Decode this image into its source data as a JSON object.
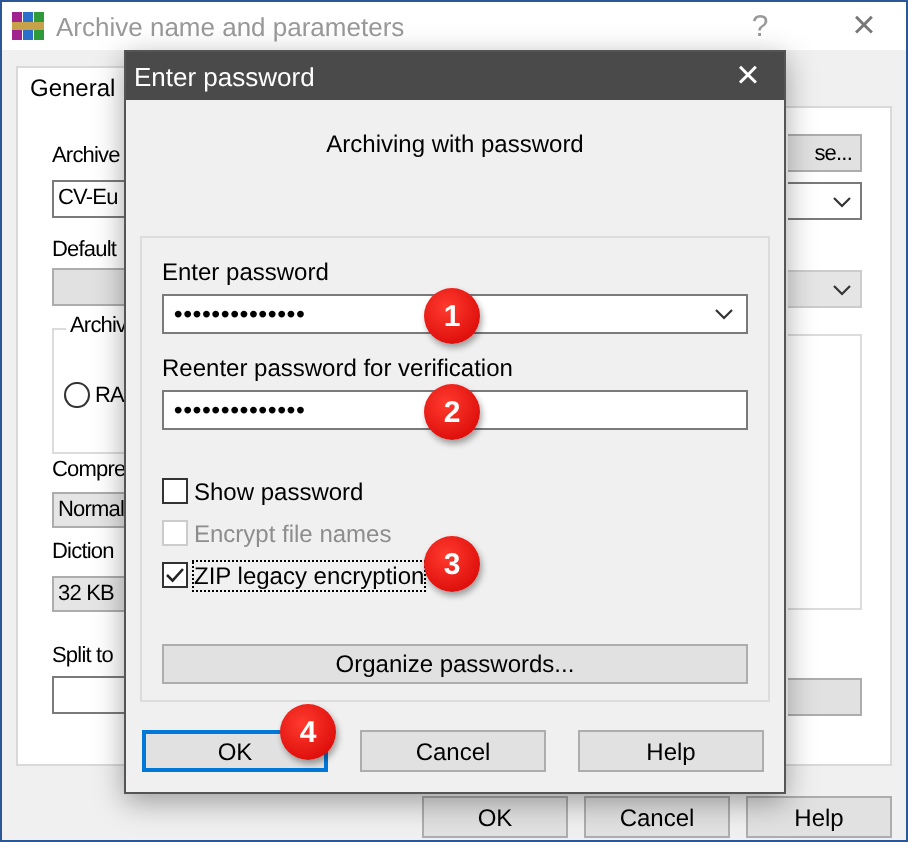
{
  "main_window": {
    "title": "Archive name and parameters",
    "help": "?",
    "close": "×",
    "tabs": [
      {
        "label": "General",
        "selected": true
      }
    ],
    "left_items": [
      {
        "kind": "label",
        "text": "Archive"
      },
      {
        "kind": "field",
        "text": "CV-Eu"
      },
      {
        "kind": "label",
        "text": "Default"
      },
      {
        "kind": "button"
      },
      {
        "kind": "group",
        "text": "Archiv",
        "radio": {
          "label": "RA",
          "selected": false
        }
      },
      {
        "kind": "label",
        "text": "Compre"
      },
      {
        "kind": "combo",
        "text": "Normal"
      },
      {
        "kind": "label",
        "text": "Diction"
      },
      {
        "kind": "combo",
        "text": "32 KB"
      },
      {
        "kind": "label",
        "text": "Split to"
      },
      {
        "kind": "field"
      }
    ],
    "right_items": [
      {
        "kind": "button",
        "text": "se..."
      },
      {
        "kind": "dropdown"
      },
      {
        "kind": "greydropdown"
      },
      {
        "kind": "group"
      },
      {
        "kind": "greyfield"
      }
    ],
    "buttons": [
      "OK",
      "Cancel",
      "Help"
    ]
  },
  "dialog": {
    "title": "Enter password",
    "close": "×",
    "heading": "Archiving with password",
    "password": {
      "label": "Enter password",
      "value": "••••••••••••••"
    },
    "reenter": {
      "label": "Reenter password for verification",
      "value": "••••••••••••••"
    },
    "checkboxes": [
      {
        "label": "Show password",
        "checked": false,
        "disabled": false,
        "focused": false
      },
      {
        "label": "Encrypt file names",
        "checked": false,
        "disabled": true,
        "focused": false
      },
      {
        "label": "ZIP legacy encryption",
        "checked": true,
        "disabled": false,
        "focused": true
      }
    ],
    "organize": "Organize passwords...",
    "buttons": [
      {
        "label": "OK",
        "default": true
      },
      {
        "label": "Cancel",
        "default": false
      },
      {
        "label": "Help",
        "default": false
      }
    ],
    "callouts": [
      "1",
      "2",
      "3",
      "4"
    ]
  }
}
